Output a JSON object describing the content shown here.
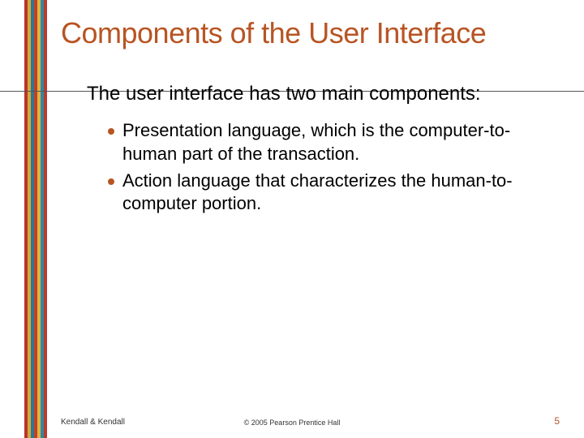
{
  "title": "Components of the User Interface",
  "intro": "The user interface has two main components:",
  "bullets": [
    "Presentation language, which is the computer-to-human part of the transaction.",
    "Action language that characterizes the human-to-computer portion."
  ],
  "footer": {
    "left": "Kendall & Kendall",
    "center": "© 2005 Pearson Prentice Hall",
    "page": "5"
  },
  "colors": {
    "accent": "#b85423"
  }
}
